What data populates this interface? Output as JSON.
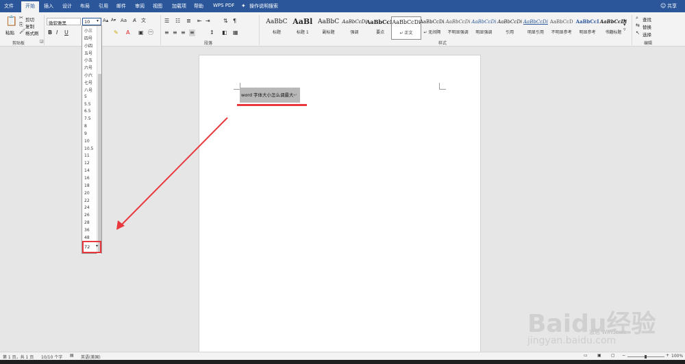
{
  "tabs": [
    {
      "label": "文件",
      "active": false
    },
    {
      "label": "开始",
      "active": true
    },
    {
      "label": "插入",
      "active": false
    },
    {
      "label": "设计",
      "active": false
    },
    {
      "label": "布局",
      "active": false
    },
    {
      "label": "引用",
      "active": false
    },
    {
      "label": "邮件",
      "active": false
    },
    {
      "label": "审阅",
      "active": false
    },
    {
      "label": "视图",
      "active": false
    },
    {
      "label": "加载项",
      "active": false
    },
    {
      "label": "帮助",
      "active": false
    },
    {
      "label": "WPS PDF",
      "active": false
    }
  ],
  "tell_me": "操作说明搜索",
  "share": "共享",
  "clipboard": {
    "paste": "粘贴",
    "cut": "剪切",
    "copy": "复制",
    "format_painter": "格式刷",
    "group": "剪贴板"
  },
  "font": {
    "name": "微软雅黑",
    "size": "10"
  },
  "paragraph_group": "段落",
  "styles": {
    "group": "样式",
    "tiles": [
      {
        "sample": "AaBbC",
        "name": "标题",
        "selected": false
      },
      {
        "sample": "AaBl",
        "name": "标题 1",
        "selected": false
      },
      {
        "sample": "AaBbC",
        "name": "副标题",
        "selected": false
      },
      {
        "sample": "AaBbCcDi",
        "name": "强调",
        "selected": false
      },
      {
        "sample": "AaBbCcD",
        "name": "要点",
        "selected": false
      },
      {
        "sample": "AaBbCcDi",
        "name": "↵ 正文",
        "selected": true
      },
      {
        "sample": "AaBbCcDi",
        "name": "↵ 无间隔",
        "selected": false
      },
      {
        "sample": "AaBbCcDi",
        "name": "不明显强调",
        "selected": false
      },
      {
        "sample": "AaBbCcDi",
        "name": "明显强调",
        "selected": false
      },
      {
        "sample": "AaBbCcDi",
        "name": "引用",
        "selected": false
      },
      {
        "sample": "AaBbCcDi",
        "name": "明显引用",
        "selected": false
      },
      {
        "sample": "AaBbCcD",
        "name": "不明显参考",
        "selected": false
      },
      {
        "sample": "AaBbCcI",
        "name": "明显参考",
        "selected": false
      },
      {
        "sample": "AaBbCcDi",
        "name": "书籍标题",
        "selected": false
      }
    ]
  },
  "editing": {
    "find": "查找",
    "replace": "替换",
    "select": "选择",
    "group": "编辑"
  },
  "font_size_dropdown": {
    "items": [
      "小三",
      "四号",
      "小四",
      "五号",
      "小五",
      "六号",
      "小六",
      "七号",
      "八号",
      "5",
      "5.5",
      "6.5",
      "7.5",
      "8",
      "9",
      "10",
      "10.5",
      "11",
      "12",
      "14",
      "16",
      "18",
      "20",
      "22",
      "24",
      "26",
      "28",
      "36",
      "48"
    ],
    "input_value": "72"
  },
  "document": {
    "selected_text": "word 字体大小怎么调最大"
  },
  "status": {
    "page": "第 1 页，共 1 页",
    "words": "10/10 个字",
    "language": "英语(美国)",
    "zoom": "100%"
  },
  "watermark": {
    "activate": "激活 Windows",
    "baidu": "Baidu经验",
    "url": "jingyan.baidu.com"
  },
  "colors": {
    "accent": "#2b579a",
    "annotation": "#e8383d"
  }
}
